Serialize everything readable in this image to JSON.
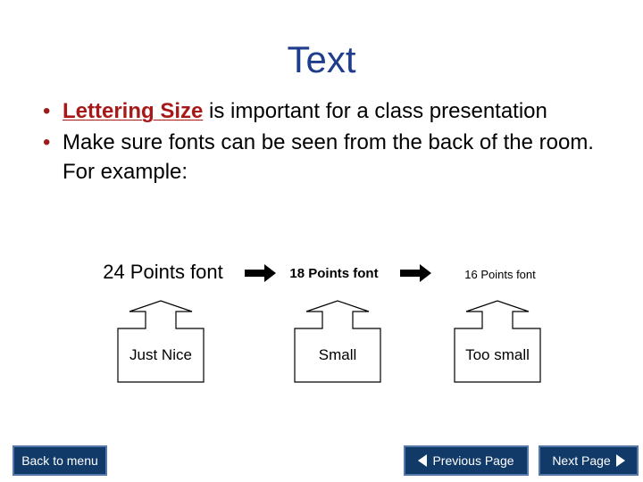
{
  "slide": {
    "title": "Text",
    "title_color": "#1F3D8C",
    "background_color": "#ffffff"
  },
  "bullets": [
    {
      "emphasis": "Lettering Size",
      "rest": " is important for a class presentation",
      "emphasis_color": "#A81818",
      "bullet_char": "•"
    },
    {
      "emphasis": "",
      "rest": "Make sure fonts can be seen from the back of the room. For example:",
      "emphasis_color": "#A81818",
      "bullet_char": "•"
    }
  ],
  "size_samples": [
    {
      "label": "24 Points font"
    },
    {
      "label": "18 Points font"
    },
    {
      "label": "16 Points font"
    }
  ],
  "arrows": [
    {
      "name": "right-arrow-24-to-18"
    },
    {
      "name": "right-arrow-18-to-16"
    }
  ],
  "callouts": [
    {
      "label": "Just Nice"
    },
    {
      "label": "Small"
    },
    {
      "label": "Too small"
    }
  ],
  "navigation": {
    "back_to_menu": "Back to menu",
    "previous_page": "Previous Page",
    "next_page": "Next Page",
    "button_color": "#113A68",
    "button_border_color": "#5577AA",
    "button_text_color": "#ffffff"
  }
}
